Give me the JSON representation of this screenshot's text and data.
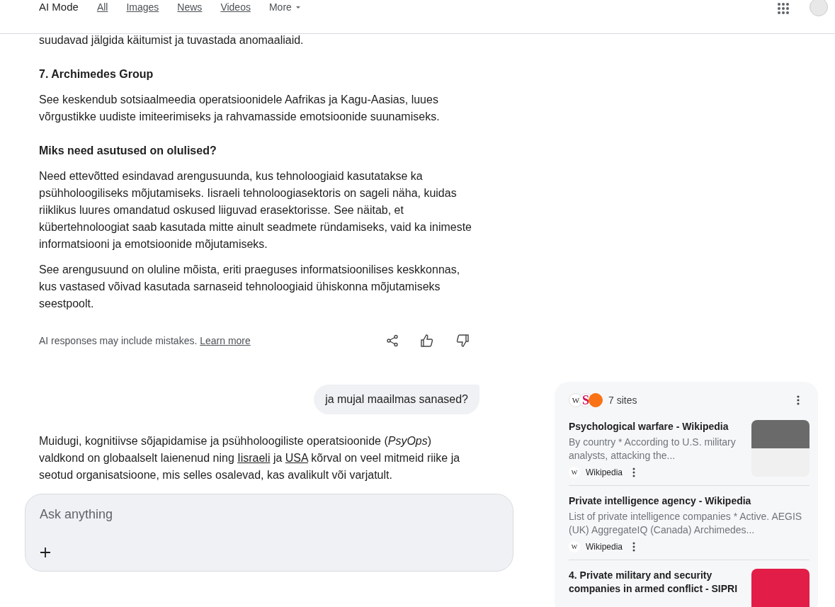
{
  "nav": {
    "tabs": [
      {
        "label": "AI Mode",
        "selected": true
      },
      {
        "label": "All",
        "selected": false
      },
      {
        "label": "Images",
        "selected": false
      },
      {
        "label": "News",
        "selected": false
      },
      {
        "label": "Videos",
        "selected": false
      }
    ],
    "more": "More"
  },
  "blocks": [
    {
      "kind": "para",
      "text": "suudavad jälgida käitumist ja tuvastada anomaaliaid."
    },
    {
      "kind": "heading",
      "text": "7. Archimedes Group"
    },
    {
      "kind": "para",
      "text": "See keskendub sotsiaalmeedia operatsioonidele Aafrikas ja Kagu-Aasias, luues võrgustikke uudiste imiteerimiseks ja rahvamasside emotsioonide suunamiseks."
    },
    {
      "kind": "heading",
      "text": "Miks need asutused on olulised?"
    },
    {
      "kind": "para",
      "text": "Need ettevõtted esindavad arengusuunda, kus tehnoloogiaid kasutatakse ka psühholoogiliseks mõjutamiseks. Iisraeli tehnoloogiasektoris on sageli näha, kuidas riiklikus luures omandatud oskused liiguvad erasektorisse. See näitab, et kübertehnoloogiat saab kasutada mitte ainult seadmete ründamiseks, vaid ka inimeste informatsiooni ja emotsioonide mõjutamiseks."
    },
    {
      "kind": "para",
      "text": "See arengusuund on oluline mõista, eriti praeguses informatsioonilises keskkonnas, kus vastased võivad kasutada sarnaseid tehnoloogiaid ühiskonna mõjutamiseks seestpoolt."
    }
  ],
  "disclaimer": {
    "text": "AI responses may include mistakes.",
    "link": "Learn more"
  },
  "user_message": "ja mujal maailmas sanased?",
  "answer": [
    {
      "kind": "text",
      "text": "Muidugi, kognitiivse sõjapidamise ja psühholoogiliste operatsioonide ("
    },
    {
      "kind": "text",
      "text": "*PsyOps*"
    },
    {
      "kind": "text",
      "text": ") valdkond on globaalselt laienenud ning "
    },
    {
      "kind": "link",
      "text": "Iisraeli"
    },
    {
      "kind": "text",
      "text": " ja "
    },
    {
      "kind": "link",
      "text": "USA"
    },
    {
      "kind": "text",
      "text": " kõrval on veel mitmeid riike ja seotud organisatsioone, mis selles osalevad, kas avalikult või varjatult."
    }
  ],
  "ask": {
    "placeholder": "Ask anything"
  },
  "sources": {
    "icons": [
      {
        "kind": "letter",
        "text": "W"
      },
      {
        "kind": "red",
        "text": "S"
      },
      {
        "kind": "orange"
      }
    ],
    "count": "7 sites",
    "items": [
      {
        "title": "Psychological warfare - Wikipedia",
        "snippet": "By country * According to U.S. military analysts, attacking the...",
        "source": "Wikipedia",
        "source_icon": "W",
        "kind": "photo"
      },
      {
        "title": "Private intelligence agency - Wikipedia",
        "snippet": "List of private intelligence companies * Active. AEGIS (UK) AggregateIQ (Canada) Archimedes...",
        "source": "Wikipedia",
        "source_icon": "W",
        "kind": "plain"
      },
      {
        "title": "4. Private military and security companies in armed conflict - SIPRI",
        "kind": "cover"
      }
    ]
  }
}
